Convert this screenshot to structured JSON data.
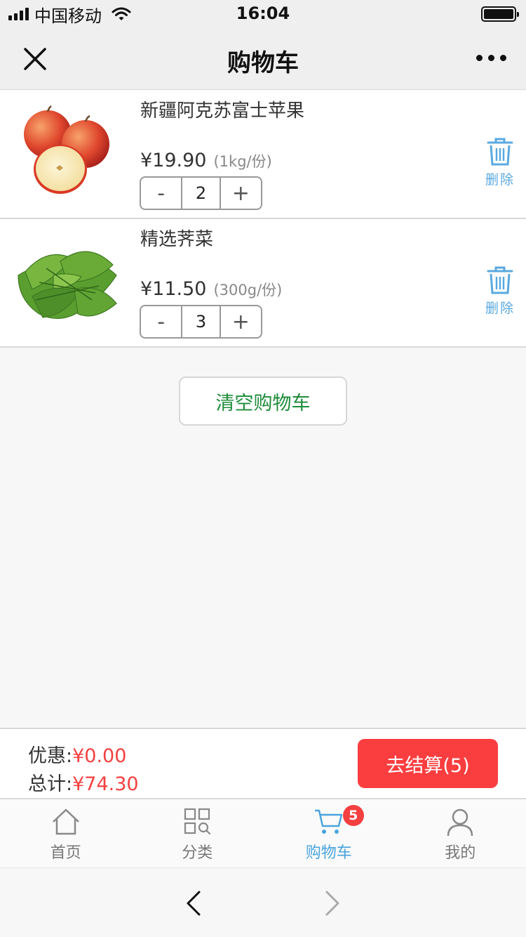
{
  "status_bar": {
    "carrier": "中国移动",
    "time": "16:04"
  },
  "nav": {
    "title": "购物车",
    "close_icon": "close-icon",
    "more_icon": "more-dots-icon"
  },
  "cart": {
    "items": [
      {
        "name": "新疆阿克苏富士苹果",
        "price": "¥19.90",
        "unit": "(1kg/份)",
        "quantity": "2",
        "minus": "-",
        "plus": "+",
        "delete_label": "删除",
        "image": "apple-photo"
      },
      {
        "name": "精选荠菜",
        "price": "¥11.50",
        "unit": "(300g/份)",
        "quantity": "3",
        "minus": "-",
        "plus": "+",
        "delete_label": "删除",
        "image": "shepherds-purse-photo"
      }
    ],
    "clear_label": "清空购物车"
  },
  "summary": {
    "discount_label": "优惠:",
    "discount_value": "¥0.00",
    "total_label": "总计:",
    "total_value": "¥74.30",
    "checkout_label": "去结算(5)"
  },
  "tabbar": {
    "tabs": [
      {
        "label": "首页",
        "icon": "home-icon"
      },
      {
        "label": "分类",
        "icon": "category-grid-icon"
      },
      {
        "label": "购物车",
        "icon": "cart-icon",
        "badge": "5",
        "active": true
      },
      {
        "label": "我的",
        "icon": "user-icon"
      }
    ]
  },
  "colors": {
    "accent_blue": "#4aa4dd",
    "price_red": "#f44040",
    "checkout_red": "#fa3d3f",
    "clear_green": "#1e8c3a"
  }
}
